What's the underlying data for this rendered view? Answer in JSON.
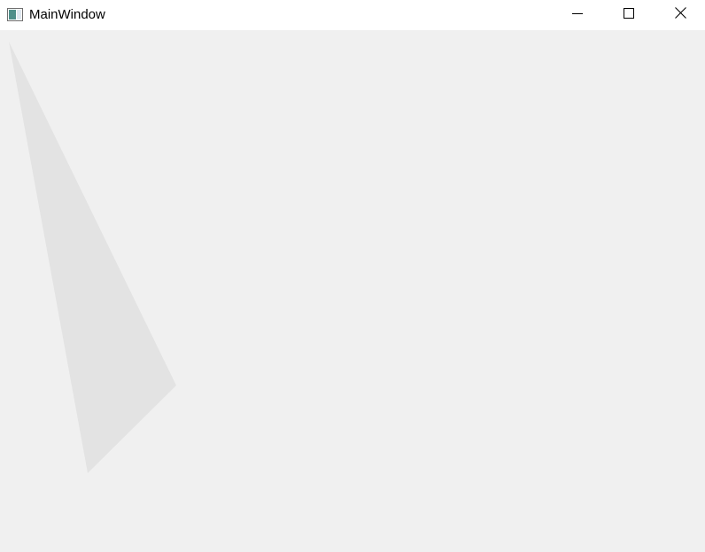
{
  "window": {
    "title": "MainWindow",
    "background_color": "#f0f0f0",
    "titlebar_color": "#ffffff"
  },
  "icons": {
    "app": "app-window-icon",
    "minimize": "minimize-icon",
    "maximize": "maximize-icon",
    "close": "close-icon"
  },
  "canvas": {
    "shape": "polygon",
    "shape_fill": "#e3e3e3"
  }
}
